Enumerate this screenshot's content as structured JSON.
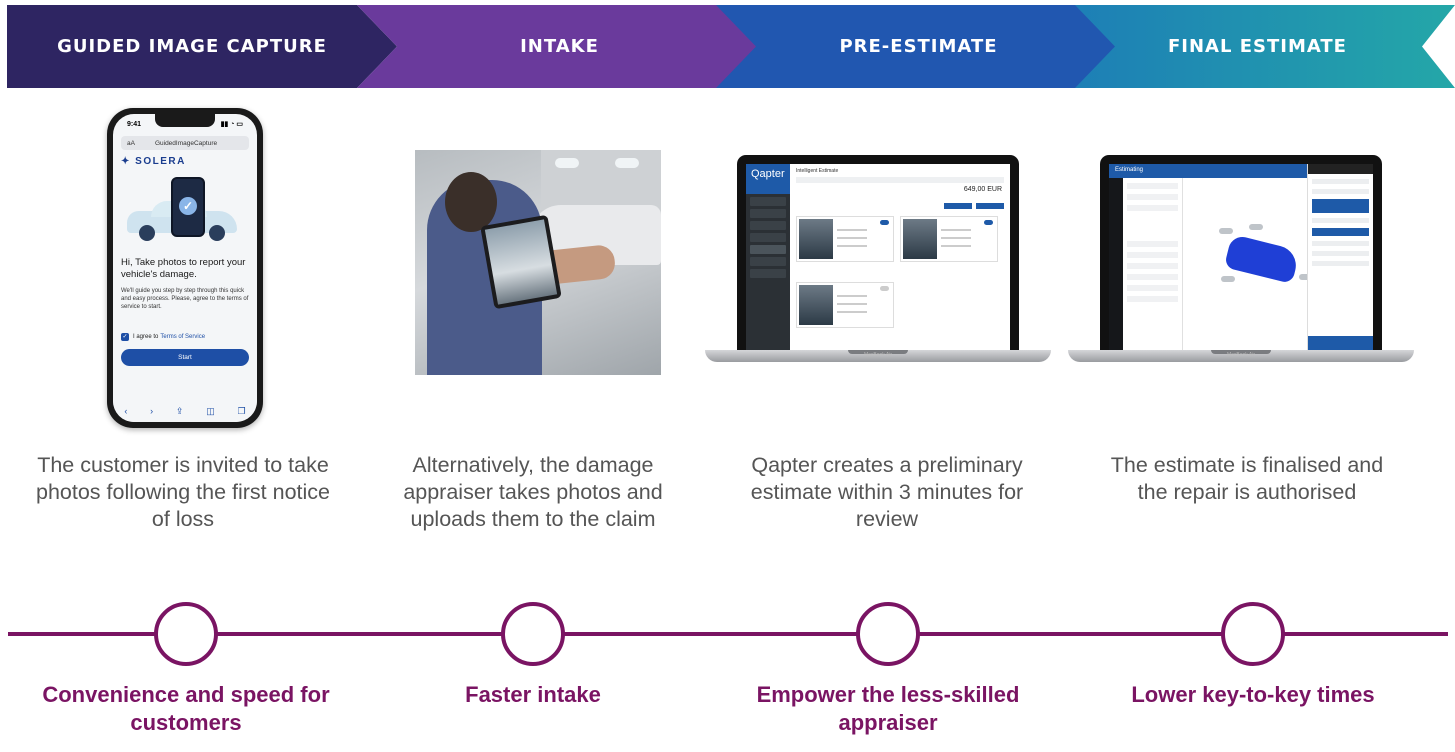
{
  "stages": [
    {
      "label": "GUIDED IMAGE CAPTURE",
      "color": "#2e2562"
    },
    {
      "label": "INTAKE",
      "color": "#6a3a9c"
    },
    {
      "label": "PRE-ESTIMATE",
      "color": "#2157b0"
    },
    {
      "label": "FINAL ESTIMATE",
      "color": "#1f9aaa"
    }
  ],
  "phone": {
    "time": "9:41",
    "url_aa": "aA",
    "url": "GuidedImageCapture",
    "logo": "SOLERA",
    "heading": "Hi, Take photos to report your vehicle's damage.",
    "body": "We'll guide you step by step through this quick and easy process. Please, agree to the terms of service to start.",
    "agree_prefix": "I agree to",
    "agree_link": "Terms of Service",
    "start": "Start"
  },
  "laptop1": {
    "brand": "Qapter",
    "title": "Intelligent Estimate",
    "price": "649,00 EUR",
    "base_label": "MacBook Air"
  },
  "laptop2": {
    "title": "Estimating",
    "base_label": "MacBook Air"
  },
  "descriptions": [
    "The customer is invited to take photos following the first notice of loss",
    "Alternatively, the damage appraiser takes photos and uploads them to the claim",
    "Qapter creates a preliminary estimate within 3 minutes for review",
    "The estimate is finalised and the repair is authorised"
  ],
  "benefits": [
    "Convenience and speed for customers",
    "Faster intake",
    "Empower the less-skilled appraiser",
    "Lower key-to-key times"
  ],
  "accent_color": "#7a1463"
}
